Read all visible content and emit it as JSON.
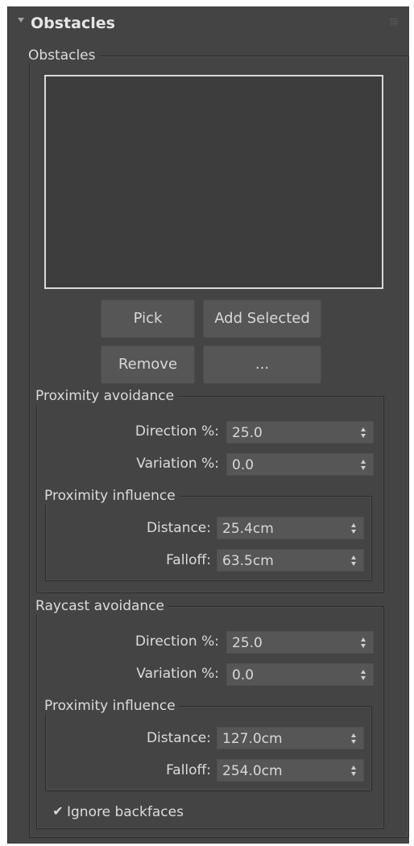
{
  "rollout": {
    "title": "Obstacles"
  },
  "obstacles_group": {
    "label": "Obstacles",
    "buttons": {
      "pick": "Pick",
      "add_selected": "Add Selected",
      "remove": "Remove",
      "more": "..."
    }
  },
  "proximity_avoidance": {
    "label": "Proximity avoidance",
    "direction": {
      "label": "Direction %:",
      "value": "25.0"
    },
    "variation": {
      "label": "Variation %:",
      "value": "0.0"
    },
    "influence": {
      "label": "Proximity influence",
      "distance": {
        "label": "Distance:",
        "value": "25.4cm"
      },
      "falloff": {
        "label": "Falloff:",
        "value": "63.5cm"
      }
    }
  },
  "raycast_avoidance": {
    "label": "Raycast avoidance",
    "direction": {
      "label": "Direction %:",
      "value": "25.0"
    },
    "variation": {
      "label": "Variation %:",
      "value": "0.0"
    },
    "influence": {
      "label": "Proximity influence",
      "distance": {
        "label": "Distance:",
        "value": "127.0cm"
      },
      "falloff": {
        "label": "Falloff:",
        "value": "254.0cm"
      }
    },
    "ignore_backfaces": {
      "label": "Ignore backfaces",
      "checked": true
    }
  }
}
